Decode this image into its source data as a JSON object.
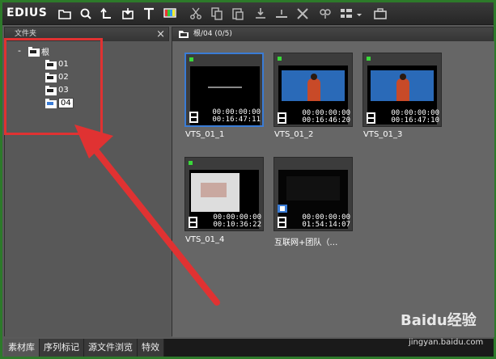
{
  "app": {
    "brand": "EDIUS"
  },
  "toolbar": {
    "icons": [
      "new-folder-icon",
      "search-icon",
      "up-folder-icon",
      "import-icon",
      "title-icon",
      "color-bars-icon",
      "cut-icon",
      "copy-icon",
      "paste-icon",
      "add-to-timeline-icon",
      "insert-icon",
      "delete-icon",
      "properties-icon",
      "view-icon",
      "dropdown-icon",
      "bin-icon"
    ]
  },
  "tree_panel": {
    "title": "文件夹",
    "close": "×",
    "root_toggle": "-",
    "root_label": "根",
    "children": [
      {
        "label": "01"
      },
      {
        "label": "02"
      },
      {
        "label": "03"
      },
      {
        "label": "04"
      }
    ]
  },
  "bin_panel": {
    "path": "根/04 (0/5)",
    "clips": [
      {
        "name": "VTS_01_1",
        "tc_in": "00:00:00:00",
        "tc_out": "00:16:47:11",
        "selected": true
      },
      {
        "name": "VTS_01_2",
        "tc_in": "00:00:00:00",
        "tc_out": "00:16:46:20",
        "selected": false
      },
      {
        "name": "VTS_01_3",
        "tc_in": "00:00:00:00",
        "tc_out": "00:16:47:10",
        "selected": false
      },
      {
        "name": "VTS_01_4",
        "tc_in": "00:00:00:00",
        "tc_out": "00:10:36:22",
        "selected": false
      },
      {
        "name": "互联网+团队（…",
        "tc_in": "00:00:00:00",
        "tc_out": "01:54:14:07",
        "selected": false
      }
    ]
  },
  "tabs": [
    {
      "label": "素材库",
      "active": true
    },
    {
      "label": "序列标记",
      "active": false
    },
    {
      "label": "源文件浏览",
      "active": false
    },
    {
      "label": "特效",
      "active": false
    }
  ],
  "watermark": {
    "brand": "Baidu经验",
    "url": "jingyan.baidu.com"
  },
  "colors": {
    "highlight": "#e03232",
    "selection": "#3a7cd6",
    "status_green": "#3ad83a"
  }
}
